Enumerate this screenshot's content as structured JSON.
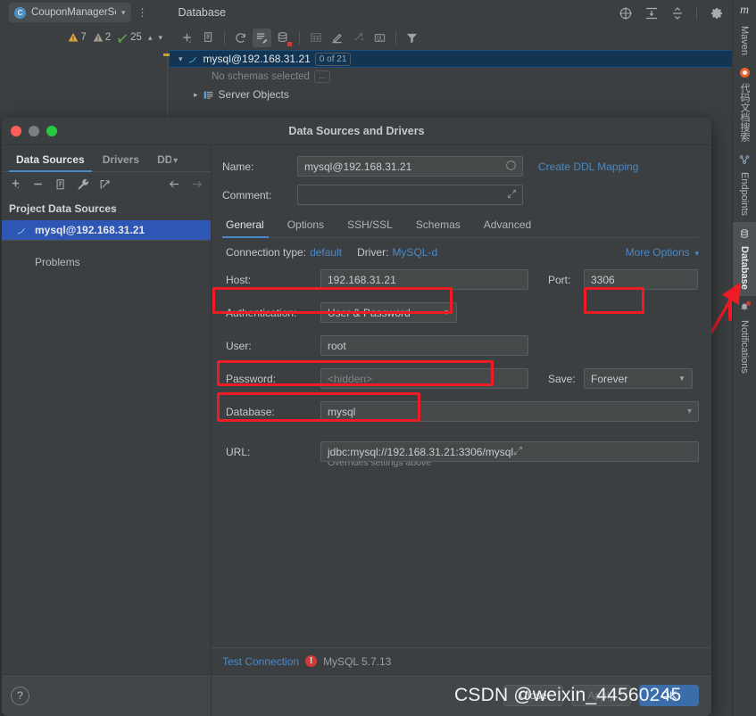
{
  "ide": {
    "project_name": "CouponManagerSer",
    "project_icon": "C",
    "tool_window_title": "Database",
    "kebab_icon": "more-vertical-icon",
    "inspections": [
      {
        "icon": "warning-triangle-icon",
        "count": "7",
        "color": "#e8a33d"
      },
      {
        "icon": "weak-warning-triangle-icon",
        "count": "2",
        "color": "#a8a08a"
      },
      {
        "icon": "check-green-icon",
        "count": "25",
        "color": "#5aa84f"
      }
    ],
    "nav_up_icon": "chevron-up-icon",
    "nav_down_icon": "chevron-down-icon",
    "window_controls": [
      {
        "name": "search-everywhere-icon"
      },
      {
        "name": "expand-all-icon"
      },
      {
        "name": "collapse-all-icon"
      },
      {
        "name": "settings-gear-icon"
      },
      {
        "name": "minimize-icon"
      }
    ],
    "db_toolbar": [
      {
        "name": "add-icon"
      },
      {
        "name": "duplicate-icon"
      },
      {
        "name": "refresh-icon"
      },
      {
        "name": "data-source-properties-icon"
      },
      {
        "name": "database-color-settings-icon"
      },
      {
        "name": "table-icon"
      },
      {
        "name": "modify-icon"
      },
      {
        "name": "jump-to-icon"
      },
      {
        "name": "query-console-icon"
      },
      {
        "name": "filter-icon"
      }
    ],
    "tree": {
      "root_label": "mysql@192.168.31.21",
      "root_badge": "0 of 21",
      "no_schemas_label": "No schemas selected",
      "ellipsis_label": "...",
      "server_objects_label": "Server Objects"
    }
  },
  "right_rail": {
    "logo": "m",
    "items": [
      {
        "label": "Maven",
        "icon": "maven-icon",
        "active": false
      },
      {
        "label": "代码文档搜索",
        "icon": "orange-dot-icon",
        "active": false
      },
      {
        "label": "Endpoints",
        "icon": "endpoints-icon",
        "active": false
      },
      {
        "label": "Database",
        "icon": "database-icon",
        "active": true
      },
      {
        "label": "Notifications",
        "icon": "bell-icon",
        "active": false
      }
    ]
  },
  "dialog": {
    "title": "Data Sources and Drivers",
    "traffic_lights": [
      "close-button",
      "minimize-button",
      "zoom-button"
    ],
    "left": {
      "tabs": [
        {
          "label": "Data Sources",
          "active": true
        },
        {
          "label": "Drivers",
          "active": false
        },
        {
          "label": "DD",
          "active": false
        }
      ],
      "tabs_overflow_icon": "chevron-down-icon",
      "toolbar": [
        {
          "name": "add-data-source-icon"
        },
        {
          "name": "remove-data-source-icon"
        },
        {
          "name": "copy-data-source-icon"
        },
        {
          "name": "wrench-icon"
        },
        {
          "name": "share-icon"
        },
        {
          "name": "back-arrow-icon"
        },
        {
          "name": "forward-arrow-icon"
        }
      ],
      "group_label": "Project Data Sources",
      "items": [
        {
          "label": "mysql@192.168.31.21",
          "icon": "mysql-dolphin-icon",
          "selected": true
        }
      ],
      "problems_label": "Problems",
      "help_label": "?"
    },
    "form": {
      "name_label": "Name:",
      "name_value": "mysql@192.168.31.21",
      "name_end_icon": "circle-icon",
      "create_ddl_mapping_label": "Create DDL Mapping",
      "comment_label": "Comment:",
      "comment_value": "",
      "comment_end_icon": "expand-editor-icon",
      "tabs": [
        {
          "label": "General",
          "active": true
        },
        {
          "label": "Options",
          "active": false
        },
        {
          "label": "SSH/SSL",
          "active": false
        },
        {
          "label": "Schemas",
          "active": false
        },
        {
          "label": "Advanced",
          "active": false
        }
      ],
      "connection_type_label": "Connection type:",
      "connection_type_value": "default",
      "driver_label": "Driver:",
      "driver_value": "MySQL-d",
      "more_options_label": "More Options",
      "more_options_icon": "chevron-down-icon",
      "host_label": "Host:",
      "host_value": "192.168.31.21",
      "port_label": "Port:",
      "port_value": "3306",
      "auth_label": "Authentication:",
      "auth_value": "User & Password",
      "user_label": "User:",
      "user_value": "root",
      "password_label": "Password:",
      "password_placeholder": "<hidden>",
      "save_label": "Save:",
      "save_value": "Forever",
      "database_label": "Database:",
      "database_value": "mysql",
      "url_label": "URL:",
      "url_value": "jdbc:mysql://192.168.31.21:3306/mysql",
      "url_end_icon": "expand-editor-icon",
      "url_hint": "Overrides settings above"
    },
    "status": {
      "test_connection_label": "Test Connection",
      "error_icon": "error-circle-icon",
      "server_version": "MySQL 5.7.13"
    },
    "buttons": [
      {
        "label": "Close",
        "kind": "normal"
      },
      {
        "label": "Apply",
        "kind": "disabled"
      },
      {
        "label": "OK",
        "kind": "primary"
      }
    ]
  },
  "annotations": {
    "highlight_color": "#ee1c25",
    "watermark": "CSDN @weixin_44560245",
    "arrow_icon": "red-arrow-icon"
  }
}
